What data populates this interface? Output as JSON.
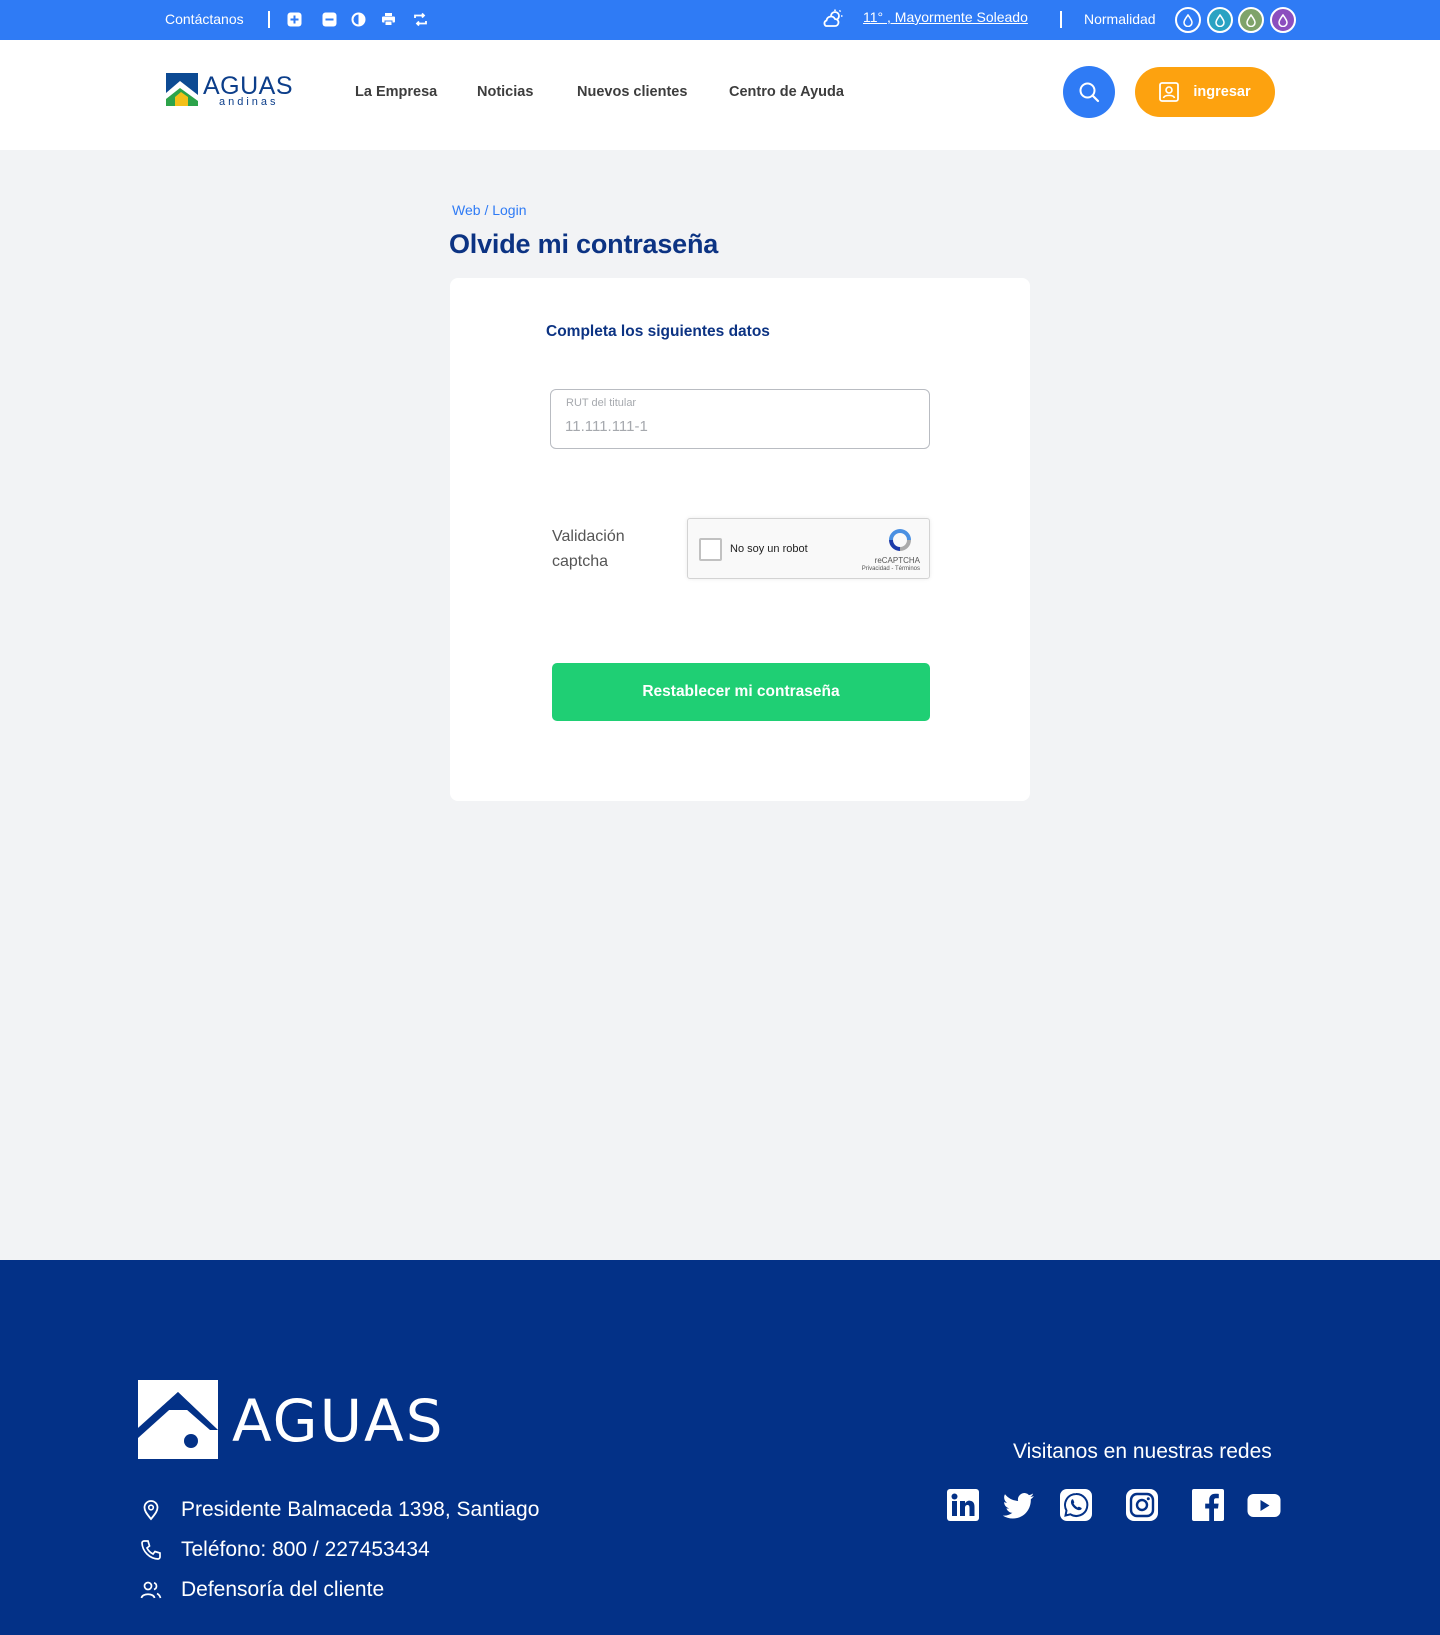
{
  "topbar": {
    "contact": "Contáctanos",
    "weather": "11° , Mayormente Soleado",
    "status": "Normalidad",
    "icons": [
      "zoom-in-icon",
      "zoom-out-icon",
      "contrast-icon",
      "print-icon",
      "reset-icon",
      "weather-icon"
    ],
    "drop_colors": [
      "#2f7bf5",
      "#2aa2c3",
      "#7fa36a",
      "#8b4fbf"
    ]
  },
  "header": {
    "logo_top": "AGUAS",
    "logo_bottom": "andinas",
    "nav": [
      "La Empresa",
      "Noticias",
      "Nuevos clientes",
      "Centro de Ayuda"
    ],
    "login_label": "ingresar"
  },
  "breadcrumb": {
    "first": "Web",
    "separator": "/",
    "current": "Login"
  },
  "page_title": "Olvide mi contraseña",
  "form": {
    "subtitle": "Completa los siguientes datos",
    "rut_label": "RUT del titular",
    "rut_placeholder": "11.111.111-1",
    "captcha_label": "Validación captcha",
    "recaptcha_text": "No soy un robot",
    "recaptcha_brand": "reCAPTCHA",
    "recaptcha_links": "Privacidad - Términos",
    "submit_label": "Restablecer mi contraseña"
  },
  "footer": {
    "logo_word": "AGUAS",
    "address": "Presidente Balmaceda 1398, Santiago",
    "phone": "Teléfono: 800 / 227453434",
    "defense": "Defensoría del cliente",
    "social_title": "Visitanos en nuestras redes",
    "social": [
      "linkedin-icon",
      "twitter-icon",
      "whatsapp-icon",
      "instagram-icon",
      "facebook-icon",
      "youtube-icon"
    ]
  },
  "colors": {
    "primary": "#2f7bf5",
    "navy": "#033187",
    "title": "#0c3383",
    "orange": "#fda20f",
    "green": "#1fcf74"
  }
}
